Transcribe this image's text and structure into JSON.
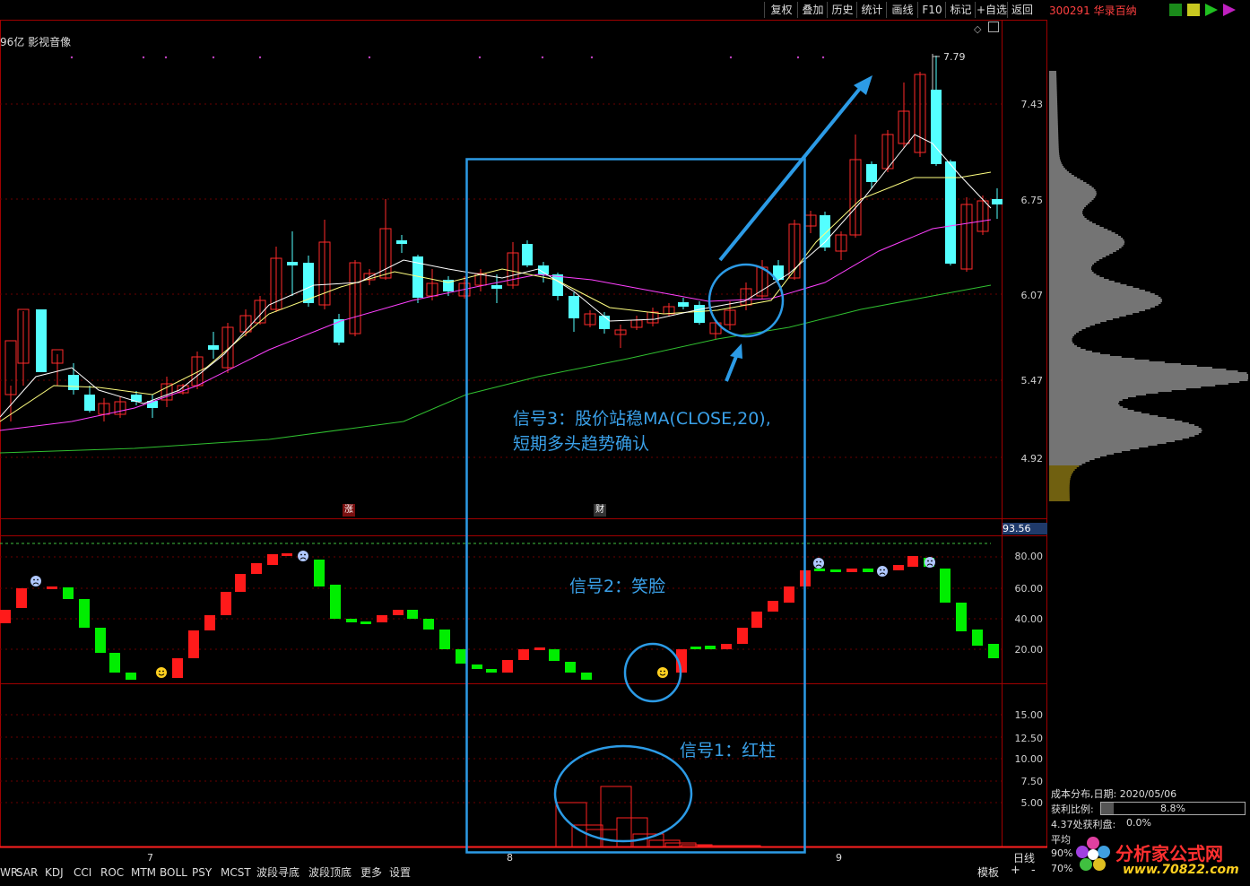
{
  "toolbar": {
    "buttons": [
      "复权",
      "叠加",
      "历史",
      "统计",
      "画线",
      "F10",
      "标记",
      "+自选",
      "返回"
    ]
  },
  "stock": {
    "code_name": "300291 华录百纳",
    "info": "96亿 影视音像"
  },
  "main_chart": {
    "high_label": "7.79",
    "y_ticks": [
      "7.43",
      "6.75",
      "6.07",
      "5.47",
      "4.92"
    ],
    "markers": [
      "涨",
      "财"
    ]
  },
  "indicator": {
    "top_value": "93.56",
    "y_ticks": [
      "80.00",
      "60.00",
      "40.00",
      "20.00"
    ]
  },
  "volume": {
    "y_ticks": [
      "15.00",
      "12.50",
      "10.00",
      "7.50",
      "5.00"
    ]
  },
  "x_axis": {
    "labels": [
      "7",
      "8",
      "9"
    ],
    "period": "日线"
  },
  "annotations": {
    "signal3_line1": "信号3：股价站稳MA(CLOSE,20),",
    "signal3_line2": "短期多头趋势确认",
    "signal2": "信号2：笑脸",
    "signal1": "信号1：红柱"
  },
  "bottom_tabs": [
    "WR",
    "SAR",
    "KDJ",
    "CCI",
    "ROC",
    "MTM",
    "BOLL",
    "PSY",
    "MCST",
    "波段寻底",
    "波段顶底",
    "更多",
    "设置"
  ],
  "bottom_right": {
    "template": "模板",
    "plus": "+",
    "minus": "-"
  },
  "cost_dist": {
    "title": "成本分布,日期: 2020/05/06",
    "profit_ratio_label": "获利比例:",
    "profit_ratio_value": "8.8%",
    "profit_at_label": "4.37处获利盘:",
    "profit_at_value": "0.0%",
    "avg_label": "平均",
    "row_90": "90%",
    "row_70": "70%"
  },
  "watermark": {
    "text": "分析家公式网",
    "url": "www.70822.com"
  },
  "colors": {
    "up": "#ff2a2a",
    "down": "#54ffff",
    "ma5": "#ffffff",
    "ma10": "#ffff80",
    "ma20": "#ff40ff",
    "ma60": "#30c030",
    "annotation": "#2c9be6",
    "green_bar": "#00ee00",
    "red_bar": "#ff1a1a"
  }
}
